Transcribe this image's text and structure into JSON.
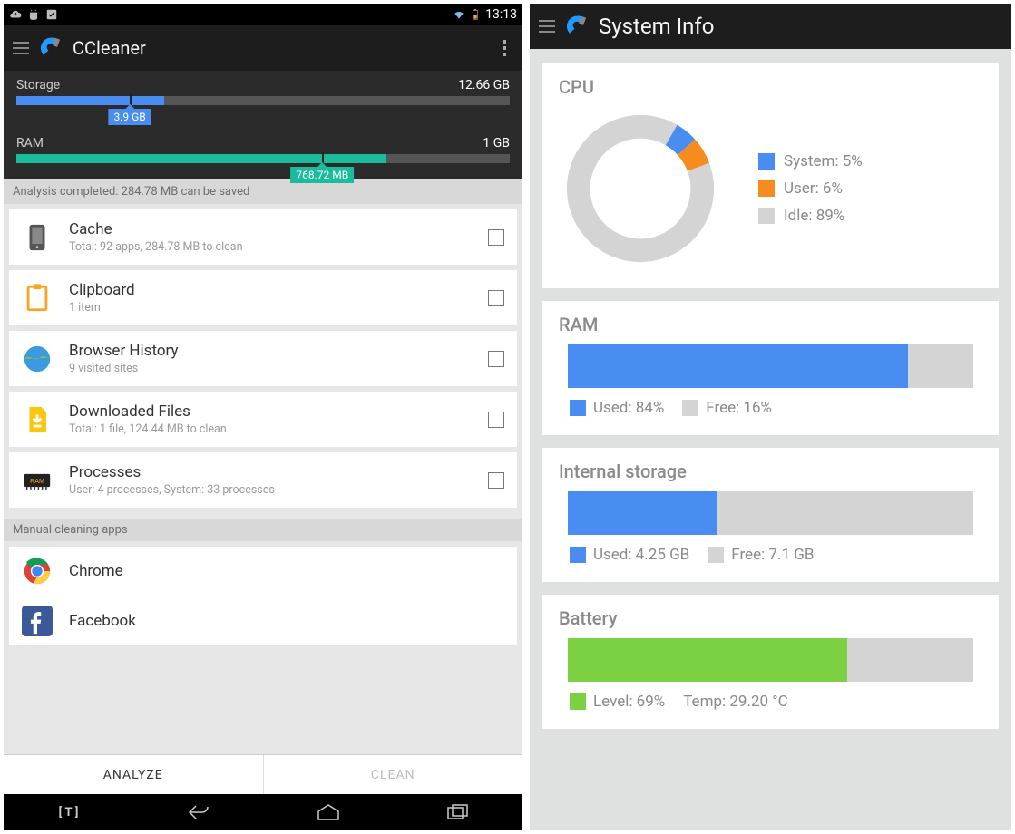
{
  "colors": {
    "blue": "#4a8df0",
    "teal": "#1bbc9b",
    "orange": "#f68b1e",
    "grey": "#d3d4d3",
    "green": "#7bd142",
    "yellow": "#f9c80e"
  },
  "left": {
    "statusbar": {
      "time": "13:13"
    },
    "header": {
      "title": "CCleaner"
    },
    "storage": {
      "label": "Storage",
      "total": "12.66 GB",
      "used_label": "3.9 GB",
      "fill_pct": 30,
      "marker_pct": 23
    },
    "ram": {
      "label": "RAM",
      "total": "1 GB",
      "used_label": "768.72 MB",
      "fill_pct": 75,
      "marker_pct": 62
    },
    "analysis_banner": "Analysis completed: 284.78 MB can be saved",
    "items": [
      {
        "icon": "phone",
        "title": "Cache",
        "sub": "Total: 92 apps, 284.78 MB to clean"
      },
      {
        "icon": "clipboard",
        "title": "Clipboard",
        "sub": "1 item"
      },
      {
        "icon": "globe",
        "title": "Browser History",
        "sub": "9 visited sites"
      },
      {
        "icon": "download",
        "title": "Downloaded Files",
        "sub": "Total: 1 file, 124.44 MB to clean"
      },
      {
        "icon": "ram",
        "title": "Processes",
        "sub": "User: 4 processes, System: 33 processes"
      }
    ],
    "manual_header": "Manual cleaning apps",
    "manual_apps": [
      {
        "icon": "chrome",
        "title": "Chrome"
      },
      {
        "icon": "facebook",
        "title": "Facebook"
      }
    ],
    "buttons": {
      "analyze": "ANALYZE",
      "clean": "CLEAN"
    }
  },
  "right": {
    "header": {
      "title": "System Info"
    },
    "cpu": {
      "title": "CPU",
      "entries": [
        {
          "label": "System",
          "value": "5%",
          "color": "#4a8df0"
        },
        {
          "label": "User",
          "value": "6%",
          "color": "#f68b1e"
        },
        {
          "label": "Idle",
          "value": "89%",
          "color": "#d3d4d3"
        }
      ]
    },
    "ram": {
      "title": "RAM",
      "used_label": "Used: 84%",
      "free_label": "Free: 16%",
      "fill_pct": 84,
      "color": "#4a8df0"
    },
    "storage": {
      "title": "Internal storage",
      "used_label": "Used: 4.25 GB",
      "free_label": "Free: 7.1 GB",
      "fill_pct": 37,
      "color": "#4a8df0"
    },
    "battery": {
      "title": "Battery",
      "level_label": "Level: 69%",
      "temp_label": "Temp: 29.20 °C",
      "fill_pct": 69,
      "color": "#7bd142"
    }
  },
  "chart_data": [
    {
      "type": "bar",
      "title": "Storage",
      "categories": [
        "Used"
      ],
      "values": [
        3.9
      ],
      "ylim": [
        0,
        12.66
      ],
      "ylabel": "GB"
    },
    {
      "type": "bar",
      "title": "RAM (device)",
      "categories": [
        "Used"
      ],
      "values": [
        768.72
      ],
      "ylim": [
        0,
        1024
      ],
      "ylabel": "MB"
    },
    {
      "type": "pie",
      "title": "CPU",
      "series": [
        {
          "name": "System",
          "values": [
            5
          ]
        },
        {
          "name": "User",
          "values": [
            6
          ]
        },
        {
          "name": "Idle",
          "values": [
            89
          ]
        }
      ]
    },
    {
      "type": "bar",
      "title": "RAM",
      "categories": [
        "Used",
        "Free"
      ],
      "values": [
        84,
        16
      ],
      "ylabel": "%"
    },
    {
      "type": "bar",
      "title": "Internal storage",
      "categories": [
        "Used",
        "Free"
      ],
      "values": [
        4.25,
        7.1
      ],
      "ylabel": "GB"
    },
    {
      "type": "bar",
      "title": "Battery",
      "categories": [
        "Level"
      ],
      "values": [
        69
      ],
      "ylim": [
        0,
        100
      ],
      "ylabel": "%",
      "annotations": [
        "Temp 29.20 °C"
      ]
    }
  ]
}
